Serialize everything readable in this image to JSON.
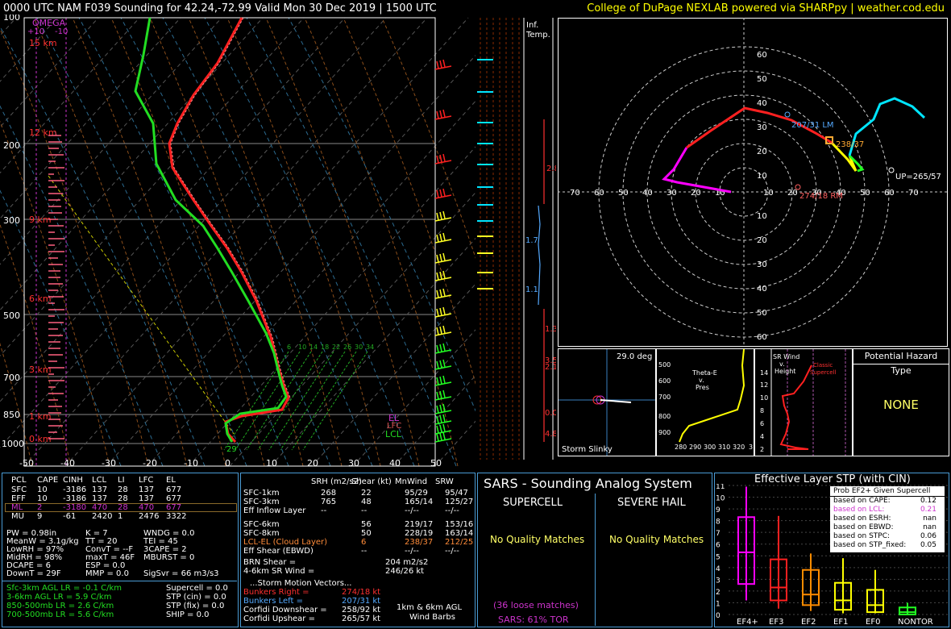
{
  "header": {
    "title": "0000 UTC NAM F039 Sounding for 42.24,-72.99 Valid  Mon 30 Dec 2019 | 1500 UTC",
    "credit": "College of DuPage NEXLAB powered via SHARPpy | weather.cod.edu"
  },
  "skewt": {
    "pressure_labels": [
      "100",
      "200",
      "300",
      "500",
      "700",
      "850",
      "1000"
    ],
    "temp_labels": [
      "-50",
      "-40",
      "-30",
      "-20",
      "-10",
      "0",
      "10",
      "20",
      "30",
      "40",
      "50"
    ],
    "height_labels": [
      "15 km",
      "12 km",
      "9 km",
      "6 km",
      "3 km",
      "1 km",
      "0 km"
    ],
    "omega_label": "OMEGA",
    "omega_p10": "+10",
    "omega_m10": "-10",
    "el_label": "EL",
    "lfc_label": "LFC",
    "lcl_label": "LCL",
    "sfc_temp": "29",
    "mix_labels": [
      "6",
      "10",
      "14",
      "18",
      "22",
      "26",
      "30",
      "34"
    ]
  },
  "inftemp": {
    "label1": "Inf.",
    "label2": "Temp.",
    "vals": [
      "2.8",
      "1.7",
      "1.1",
      "1.3",
      "3.5",
      "2.1",
      "0.0",
      "4.8"
    ]
  },
  "hodo": {
    "rings": [
      "60",
      "50",
      "40",
      "30",
      "20",
      "10"
    ],
    "xlabels": [
      "70",
      "60",
      "50",
      "40",
      "30",
      "20",
      "10",
      "10",
      "20",
      "30",
      "40",
      "50",
      "60",
      "70"
    ],
    "ylabels_bottom": [
      "10",
      "20",
      "30",
      "40",
      "50",
      "60"
    ],
    "lm": "207/31 LM",
    "rm": "274/18 RM",
    "mean": "238/37",
    "up": "UP=265/57"
  },
  "slinky": {
    "angle": "29.0 deg",
    "label": "Storm Slinky"
  },
  "thetae": {
    "title1": "Theta-E",
    "title2": "v.",
    "title3": "Pres",
    "ylabels": [
      "500",
      "600",
      "700",
      "800",
      "900"
    ],
    "xlabels": [
      "280",
      "290",
      "300",
      "310",
      "320",
      "3"
    ]
  },
  "srwind": {
    "title1": "SR Wind",
    "title2": "v.",
    "title3": "Height",
    "classic": "Classic",
    "supercell": "Supercell",
    "ylabels": [
      "14",
      "12",
      "10",
      "8",
      "6",
      "4",
      "2"
    ]
  },
  "hazard": {
    "title": "Potential Hazard Type",
    "value": "NONE"
  },
  "parcels": {
    "headers": [
      "PCL",
      "CAPE",
      "CINH",
      "LCL",
      "LI",
      "LFC",
      "EL"
    ],
    "rows": [
      [
        "SFC",
        "10",
        "-3186",
        "137",
        "28",
        "137",
        "677"
      ],
      [
        "EFF",
        "10",
        "-3186",
        "137",
        "28",
        "137",
        "677"
      ],
      [
        "ML",
        "2",
        "-3180",
        "470",
        "28",
        "470",
        "677"
      ],
      [
        "MU",
        "9",
        "-61",
        "2420",
        "1",
        "2476",
        "3322"
      ]
    ]
  },
  "indices": {
    "col1": [
      "PW = 0.98in",
      "MeanW = 3.1g/kg",
      "LowRH = 97%",
      "MidRH = 98%",
      "DCAPE = 6",
      "DownT = 29F"
    ],
    "col2": [
      "K = 7",
      "TT = 20",
      "ConvT = --F",
      "maxT = 46F",
      "ESP = 0.0",
      "MMP = 0.0"
    ],
    "col3": [
      "WNDG = 0.0",
      "TEI = 45",
      "3CAPE = 2",
      "MBURST = 0",
      "",
      "SigSvr = 66 m3/s3"
    ]
  },
  "lapse": [
    "Sfc-3km AGL LR = -0.1 C/km",
    "3-6km AGL LR = 5.9 C/km",
    "850-500mb LR = 2.6 C/km",
    "700-500mb LR = 5.6 C/km"
  ],
  "svr": [
    "Supercell = 0.0",
    "STP (cin) = 0.0",
    "STP (fix) = 0.0",
    "SHIP = 0.0"
  ],
  "kin": {
    "headers": [
      "SRH (m2/s2)",
      "Shear (kt)",
      "MnWind",
      "SRW"
    ],
    "rows": [
      [
        "SFC-1km",
        "268",
        "22",
        "95/29",
        "95/47"
      ],
      [
        "SFC-3km",
        "765",
        "48",
        "165/14",
        "125/27"
      ],
      [
        "Eff Inflow Layer",
        "--",
        "--",
        "--/--",
        "--/--"
      ],
      [
        "SFC-6km",
        "",
        "56",
        "219/17",
        "153/16"
      ],
      [
        "SFC-8km",
        "",
        "50",
        "228/19",
        "163/14"
      ],
      [
        "LCL-EL (Cloud Layer)",
        "",
        "6",
        "238/37",
        "212/25"
      ],
      [
        "Eff Shear (EBWD)",
        "",
        "--",
        "--/--",
        "--/--"
      ]
    ],
    "brn": "BRN Shear =",
    "brn_v": "204 m2/s2",
    "sr46": "4-6km SR Wind =",
    "sr46_v": "246/26 kt",
    "smv": "...Storm Motion Vectors...",
    "bunr": "Bunkers Right =",
    "bunr_v": "274/18 kt",
    "bunl": "Bunkers Left =",
    "bunl_v": "207/31 kt",
    "cdn": "Corfidi Downshear =",
    "cdn_v": "258/92 kt",
    "cup": "Corfidi Upshear =",
    "cup_v": "265/57 kt",
    "barbs1": "1km & 6km AGL",
    "barbs2": "Wind Barbs"
  },
  "sars": {
    "title": "SARS - Sounding Analog System",
    "supercell": "SUPERCELL",
    "hail": "SEVERE HAIL",
    "nq1": "No Quality Matches",
    "nq2": "No Quality Matches",
    "loose": "(36 loose matches)",
    "tor": "SARS: 61% TOR"
  },
  "stp": {
    "title": "Effective Layer STP (with CIN)",
    "box_title": "Prob EF2+ Given Supercell",
    "rows": [
      [
        "based on CAPE:",
        "0.12"
      ],
      [
        "based on LCL:",
        "0.21"
      ],
      [
        "based on ESRH:",
        "nan"
      ],
      [
        "based on EBWD:",
        "nan"
      ],
      [
        "based on STPC:",
        "0.06"
      ],
      [
        "based on STP_fixed:",
        "0.05"
      ]
    ],
    "ylabels": [
      "11",
      "10",
      "9",
      "8",
      "7",
      "6",
      "5",
      "4",
      "3",
      "2",
      "1",
      "0"
    ],
    "cats": [
      "EF4+",
      "EF3",
      "EF2",
      "EF1",
      "EF0",
      "NONTOR"
    ]
  }
}
